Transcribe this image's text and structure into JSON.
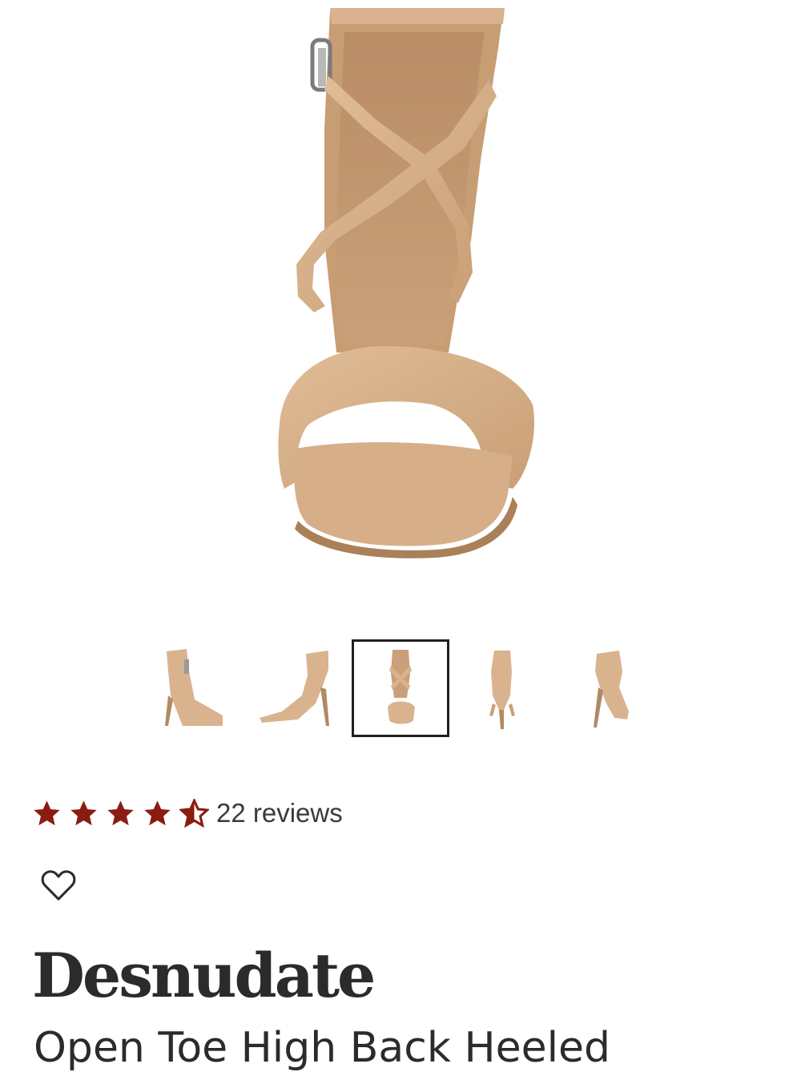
{
  "product": {
    "brand": "Desnudate",
    "name": "Open Toe High Back Heeled",
    "main_image": {
      "alt": "main-product-image"
    },
    "thumbnails": [
      {
        "view": "side-angle"
      },
      {
        "view": "side"
      },
      {
        "view": "front",
        "selected": true
      },
      {
        "view": "back"
      },
      {
        "view": "rear-angle"
      }
    ]
  },
  "rating": {
    "value": 4.5,
    "max": 5,
    "reviews_label": "22 reviews",
    "star_color": "#8b1c12"
  },
  "wishlist": {
    "icon": "heart-icon"
  },
  "colors": {
    "shoe": "#d9b38e",
    "shoe_dark": "#a98057",
    "selected_border": "#1f1f1f"
  }
}
